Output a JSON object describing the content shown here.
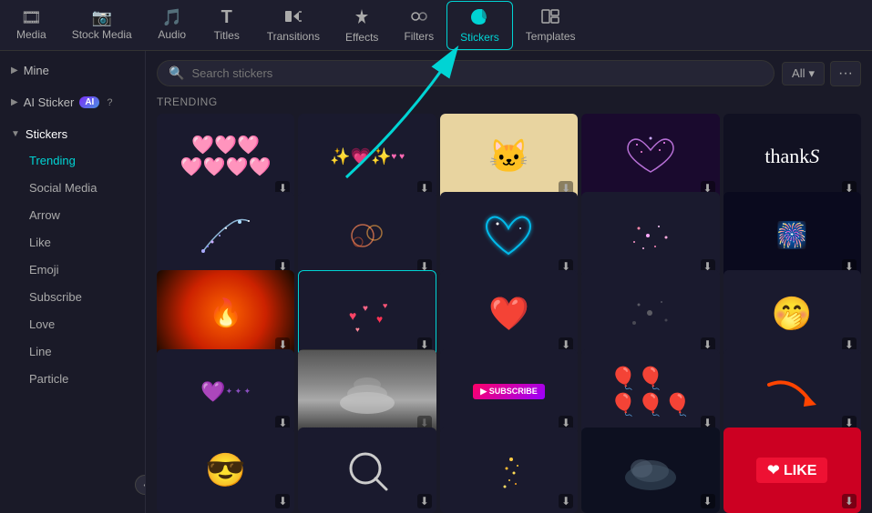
{
  "nav": {
    "items": [
      {
        "label": "Media",
        "icon": "🎞",
        "active": false
      },
      {
        "label": "Stock Media",
        "icon": "📷",
        "active": false
      },
      {
        "label": "Audio",
        "icon": "🎵",
        "active": false
      },
      {
        "label": "Titles",
        "icon": "T",
        "active": false
      },
      {
        "label": "Transitions",
        "icon": "⟹",
        "active": false
      },
      {
        "label": "Effects",
        "icon": "✦",
        "active": false
      },
      {
        "label": "Filters",
        "icon": "◈",
        "active": false
      },
      {
        "label": "Stickers",
        "icon": "⬡",
        "active": true
      },
      {
        "label": "Templates",
        "icon": "⊟",
        "active": false
      }
    ]
  },
  "sidebar": {
    "mine_label": "Mine",
    "ai_sticker_label": "AI Sticker",
    "stickers_label": "Stickers",
    "items": [
      {
        "label": "Trending",
        "active": true
      },
      {
        "label": "Social Media",
        "active": false
      },
      {
        "label": "Arrow",
        "active": false
      },
      {
        "label": "Like",
        "active": false
      },
      {
        "label": "Emoji",
        "active": false
      },
      {
        "label": "Subscribe",
        "active": false
      },
      {
        "label": "Love",
        "active": false
      },
      {
        "label": "Line",
        "active": false
      },
      {
        "label": "Particle",
        "active": false
      }
    ]
  },
  "search": {
    "placeholder": "Search stickers",
    "filter_label": "All"
  },
  "section": {
    "trending_label": "TRENDING"
  },
  "stickers": [
    {
      "id": 1,
      "type": "hearts",
      "bg": "dark",
      "selected": false
    },
    {
      "id": 2,
      "type": "sparkle-hearts",
      "bg": "dark",
      "selected": false
    },
    {
      "id": 3,
      "type": "cat",
      "bg": "cat",
      "selected": false
    },
    {
      "id": 4,
      "type": "glitter-heart",
      "bg": "glitter",
      "selected": false
    },
    {
      "id": 5,
      "type": "thanks",
      "bg": "dark",
      "selected": false
    },
    {
      "id": 6,
      "type": "sparkle-trail",
      "bg": "dark",
      "selected": false
    },
    {
      "id": 7,
      "type": "rings",
      "bg": "dark",
      "selected": false
    },
    {
      "id": 8,
      "type": "neon-heart",
      "bg": "dark",
      "selected": false
    },
    {
      "id": 9,
      "type": "particles",
      "bg": "dark",
      "selected": false
    },
    {
      "id": 10,
      "type": "fireworks",
      "bg": "space",
      "selected": false
    },
    {
      "id": 11,
      "type": "fire-explosion",
      "bg": "fire",
      "selected": false
    },
    {
      "id": 12,
      "type": "floating-hearts",
      "bg": "dark",
      "selected": true
    },
    {
      "id": 13,
      "type": "red-heart",
      "bg": "dark",
      "selected": false
    },
    {
      "id": 14,
      "type": "scatter-particles",
      "bg": "dark",
      "selected": false
    },
    {
      "id": 15,
      "type": "laughing-emoji",
      "bg": "dark",
      "selected": false
    },
    {
      "id": 16,
      "type": "heart-glow",
      "bg": "dark",
      "selected": false
    },
    {
      "id": 17,
      "type": "smoke",
      "bg": "smoke",
      "selected": false
    },
    {
      "id": 18,
      "type": "subscribe",
      "bg": "dark",
      "selected": false
    },
    {
      "id": 19,
      "type": "balloons",
      "bg": "dark",
      "selected": false
    },
    {
      "id": 20,
      "type": "arrow-red",
      "bg": "dark",
      "selected": false
    },
    {
      "id": 21,
      "type": "sunglasses-emoji",
      "bg": "dark",
      "selected": false
    },
    {
      "id": 22,
      "type": "search-icon-sticker",
      "bg": "dark",
      "selected": false
    },
    {
      "id": 23,
      "type": "gold-particles",
      "bg": "dark",
      "selected": false
    },
    {
      "id": 24,
      "type": "cloud-dark",
      "bg": "dark",
      "selected": false
    },
    {
      "id": 25,
      "type": "like-badge",
      "bg": "red",
      "selected": false
    }
  ]
}
